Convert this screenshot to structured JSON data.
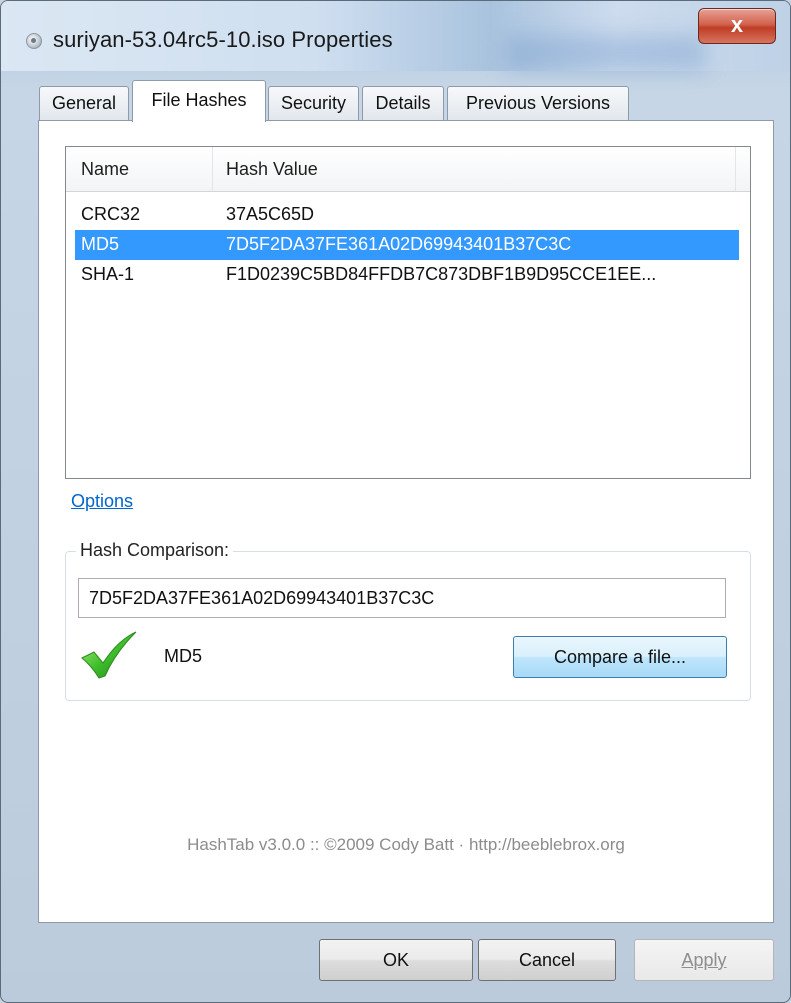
{
  "window": {
    "title": "suriyan-53.04rc5-10.iso Properties",
    "close_glyph": "x"
  },
  "tabs": [
    {
      "label": "General"
    },
    {
      "label": "File Hashes",
      "active": true
    },
    {
      "label": "Security"
    },
    {
      "label": "Details"
    },
    {
      "label": "Previous Versions"
    }
  ],
  "hash_list": {
    "columns": [
      "Name",
      "Hash Value"
    ],
    "rows": [
      {
        "name": "CRC32",
        "value": "37A5C65D"
      },
      {
        "name": "MD5",
        "value": "7D5F2DA37FE361A02D69943401B37C3C",
        "selected": true
      },
      {
        "name": "SHA-1",
        "value": "F1D0239C5BD84FFDB7C873DBF1B9D95CCE1EE..."
      }
    ]
  },
  "options_link": "Options",
  "hash_comparison": {
    "label": "Hash Comparison:",
    "value": "7D5F2DA37FE361A02D69943401B37C3C",
    "match_icon": "green-check-icon",
    "match_label": "MD5",
    "compare_button": "Compare a file..."
  },
  "footer": "HashTab v3.0.0 :: ©2009 Cody Batt  ·  http://beeblebrox.org",
  "buttons": {
    "ok": "OK",
    "cancel": "Cancel",
    "apply": "Apply"
  },
  "colors": {
    "selection": "#3399ff",
    "link": "#0066cc",
    "close_button": "#c03d26",
    "check": "#3fbf2c"
  }
}
